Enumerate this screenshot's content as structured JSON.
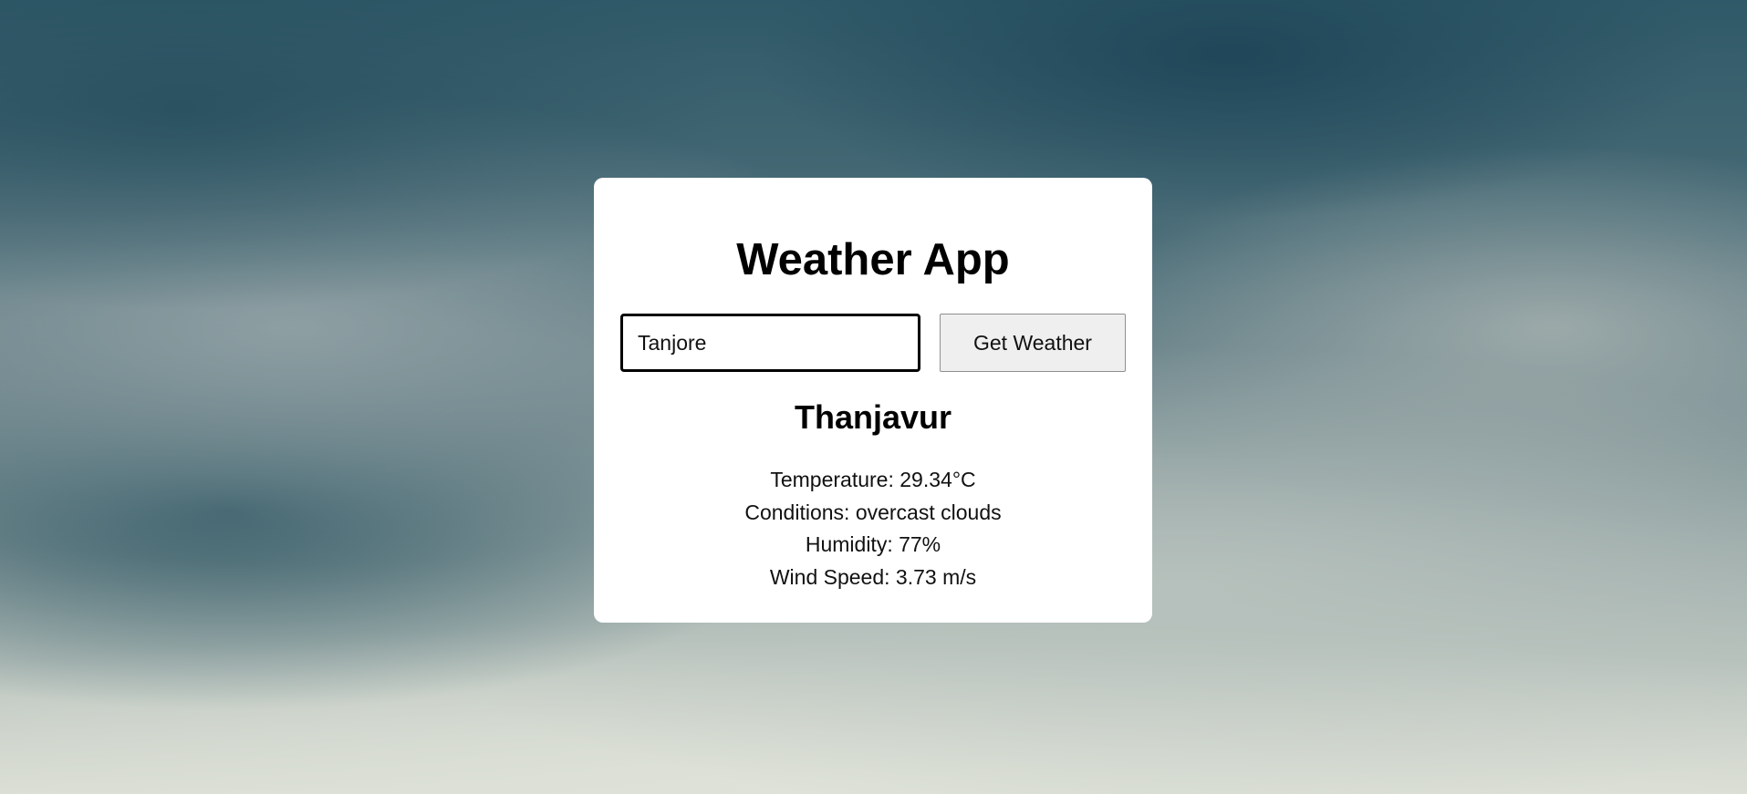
{
  "app": {
    "title": "Weather App"
  },
  "search": {
    "value": "Tanjore",
    "button_label": "Get Weather"
  },
  "result": {
    "city": "Thanjavur",
    "temperature": "Temperature: 29.34°C",
    "conditions": "Conditions: overcast clouds",
    "humidity": "Humidity: 77%",
    "wind_speed": "Wind Speed: 3.73 m/s"
  }
}
